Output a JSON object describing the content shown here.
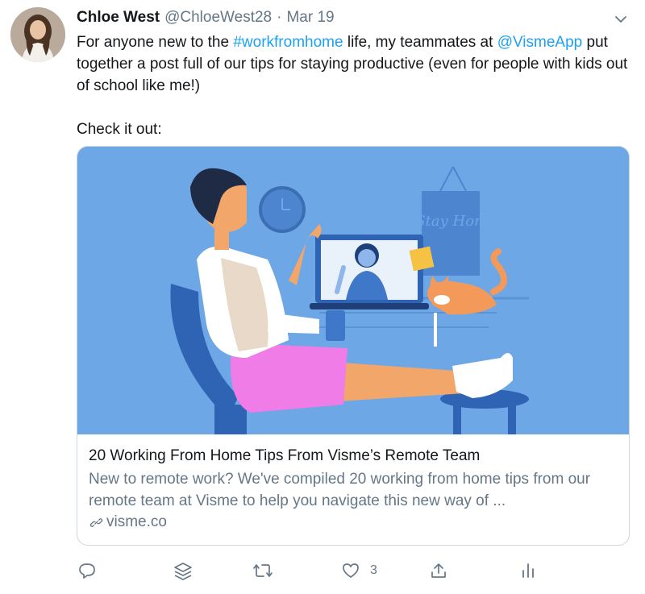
{
  "tweet": {
    "author_name": "Chloe West",
    "handle": "@ChloeWest28",
    "separator": "·",
    "date": "Mar 19",
    "body": {
      "t1": "For anyone new to the ",
      "hashtag": "#workfromhome",
      "t2": " life, my teammates at ",
      "mention": "@VismeApp",
      "t3": " put together a post full of our tips for staying productive (even for people with kids out of school like me!)",
      "line2": "Check it out:"
    },
    "card": {
      "image_text": "#Stay Home",
      "title": "20 Working From Home Tips From Visme’s Remote Team",
      "description": "New to remote work? We've compiled 20 working from home tips from our remote team at Visme to help you navigate this new way of ...",
      "domain": "visme.co"
    },
    "actions": {
      "reply_icon": "comment-icon",
      "stack_icon": "layers-icon",
      "retweet_icon": "retweet-icon",
      "like_icon": "heart-icon",
      "like_count": "3",
      "share_icon": "share-icon",
      "analytics_icon": "analytics-icon"
    }
  },
  "colors": {
    "link": "#1da1f2",
    "secondary_text": "#657786",
    "card_bg": "#6ea7e6",
    "border": "#ccd6dd"
  }
}
